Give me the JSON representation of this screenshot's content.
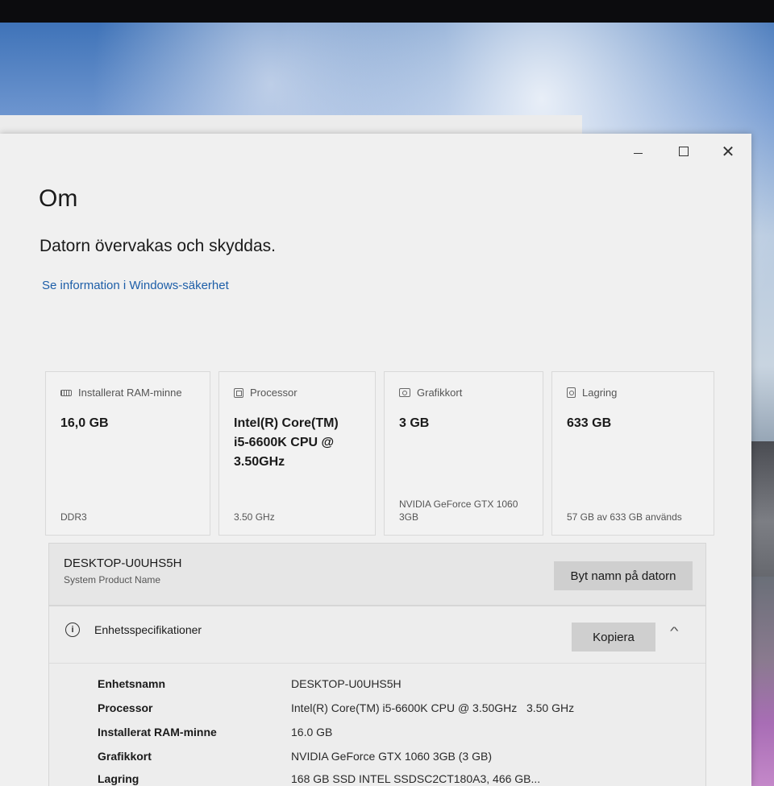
{
  "window": {
    "title": "Om",
    "status": "Datorn övervakas och skyddas.",
    "security_link": "Se information i Windows-säkerhet",
    "controls": {
      "minimize": "—",
      "maximize": "☐",
      "close": "✕"
    }
  },
  "cards": [
    {
      "label": "Installerat RAM-minne",
      "icon": "ram-icon",
      "value": "16,0 GB",
      "sub": "DDR3"
    },
    {
      "label": "Processor",
      "icon": "processor-icon",
      "value": "Intel(R) Core(TM)\ni5-6600K CPU @\n3.50GHz",
      "sub": "3.50 GHz"
    },
    {
      "label": "Grafikkort",
      "icon": "graphics-card-icon",
      "value": "3 GB",
      "sub": "NVIDIA GeForce GTX 1060\n3GB"
    },
    {
      "label": "Lagring",
      "icon": "storage-icon",
      "value": "633 GB",
      "sub": "57 GB av 633 GB används"
    }
  ],
  "device": {
    "name": "DESKTOP-U0UHS5H",
    "sub": "System Product Name",
    "rename_button": "Byt namn på datorn"
  },
  "specs": {
    "title": "Enhetsspecifikationer",
    "copy_button": "Kopiera",
    "collapse_icon": "^",
    "rows": [
      {
        "key": "Enhetsnamn",
        "value": "DESKTOP-U0UHS5H"
      },
      {
        "key": "Processor",
        "value": "Intel(R) Core(TM) i5-6600K CPU @ 3.50GHz   3.50 GHz"
      },
      {
        "key": "Installerat RAM-minne",
        "value": "16.0 GB"
      },
      {
        "key": "Grafikkort",
        "value": "NVIDIA GeForce GTX 1060 3GB (3 GB)"
      },
      {
        "key": "Lagring",
        "value": "168 GB SSD INTEL SSDSC2CT180A3, 466 GB..."
      }
    ]
  }
}
